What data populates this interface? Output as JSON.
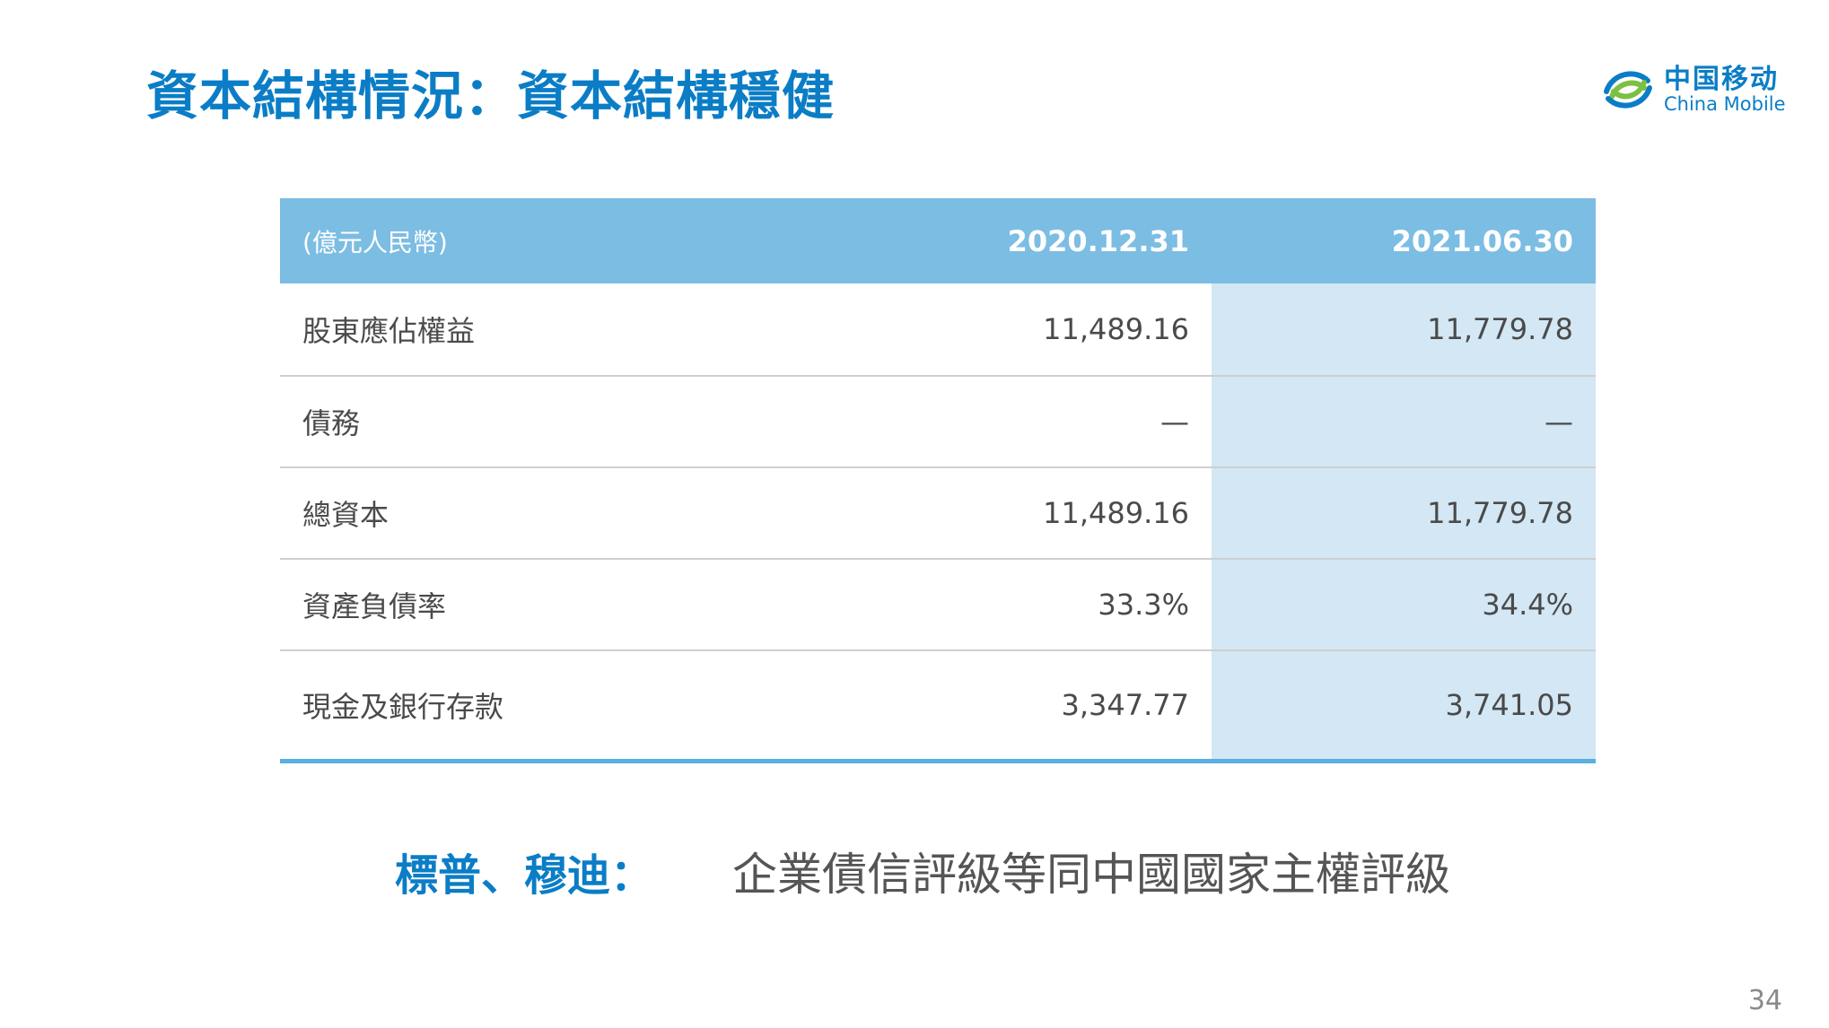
{
  "slide": {
    "title": "資本結構情況：資本結構穩健",
    "page_number": "34"
  },
  "logo": {
    "name_cn": "中国移动",
    "name_en": "China Mobile",
    "icon": "china-mobile-logo",
    "color": "#0b7dc6"
  },
  "table": {
    "unit_header": "(億元人民幣)",
    "col1_header": "2020.12.31",
    "col2_header": "2021.06.30",
    "rows": [
      {
        "label": "股東應佔權益",
        "v1": "11,489.16",
        "v2": "11,779.78"
      },
      {
        "label": "債務",
        "v1": "—",
        "v2": "—"
      },
      {
        "label": "總資本",
        "v1": "11,489.16",
        "v2": "11,779.78"
      },
      {
        "label": "資產負債率",
        "v1": "33.3%",
        "v2": "34.4%"
      },
      {
        "label": "現金及銀行存款",
        "v1": "3,347.77",
        "v2": "3,741.05"
      }
    ],
    "colors": {
      "header_bg": "#7cbde3",
      "highlight_col_bg": "#d3e7f4",
      "bottom_line": "#5aaee0"
    }
  },
  "rating": {
    "label": "標普、穆迪：",
    "text": "企業債信評級等同中國國家主權評級"
  }
}
